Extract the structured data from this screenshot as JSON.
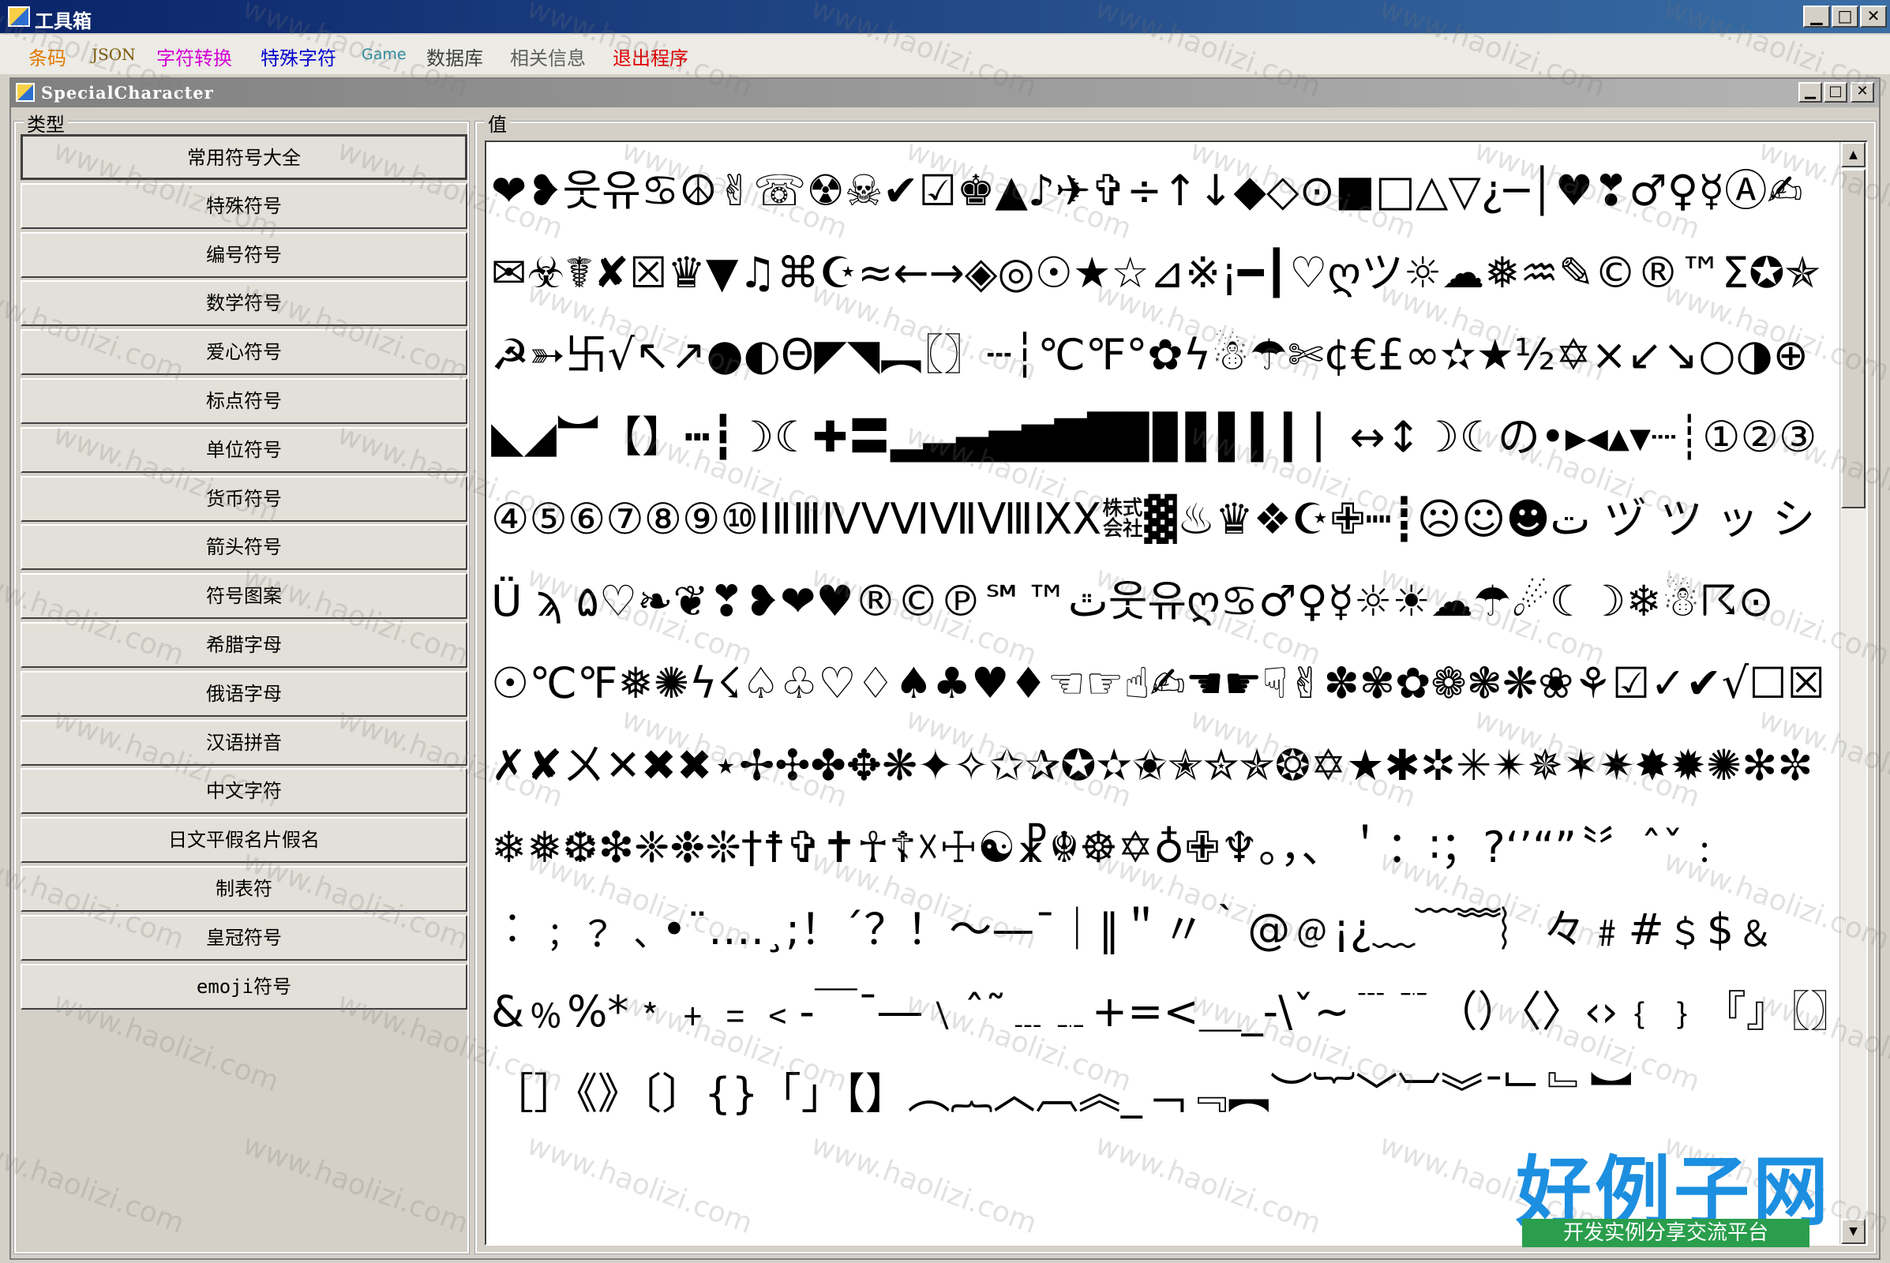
{
  "window": {
    "title": "工具箱",
    "btn_min": "▁",
    "btn_max": "□",
    "btn_close": "✕"
  },
  "menu": [
    {
      "label": "条码",
      "color": "#e07a00"
    },
    {
      "label": "JSON",
      "color": "#7a5a00"
    },
    {
      "label": "字符转换",
      "color": "#d400d4"
    },
    {
      "label": "特殊字符",
      "color": "#0000cc"
    },
    {
      "label": "Game",
      "color": "#2c8ca0"
    },
    {
      "label": "数据库",
      "color": "#404040"
    },
    {
      "label": "相关信息",
      "color": "#606060"
    },
    {
      "label": "退出程序",
      "color": "#e00000"
    }
  ],
  "child": {
    "title": "SpecialCharacter",
    "btn_min": "▁",
    "btn_max": "□",
    "btn_close": "✕"
  },
  "left_group": {
    "label": "类型",
    "categories": [
      "常用符号大全",
      "特殊符号",
      "编号符号",
      "数学符号",
      "爱心符号",
      "标点符号",
      "单位符号",
      "货币符号",
      "箭头符号",
      "符号图案",
      "希腊字母",
      "俄语字母",
      "汉语拼音",
      "中文字符",
      "日文平假名片假名",
      "制表符",
      "皇冠符号",
      "emoji符号"
    ]
  },
  "right_group": {
    "label": "值",
    "content": "❤❥웃유♋☮✌☏☢☠✔☑♚▲♪✈✞÷↑↓◆◇⊙■□△▽¿─│♥❣♂♀☿Ⓐ✍✉☣☤✘☒♛▼♫⌘☪≈←→◈◎☉★☆⊿※¡━┃♡ღツ☼☁❅♒✎©®™Σ✪✯☭➳卐√↖↗●◐Θ◤◥︻〖〗┄┆℃℉°✿ϟ☃☂✄¢€£∞✫★½✡×↙↘○◑⊕◣◢︼【】┅┇☽☾✚〓▂▃▄▅▆▇█▉▊▋▌▍▎▏↔↕☽☾の•▸◂▴▾┈┊①②③④⑤⑥⑦⑧⑨⑩ⅠⅡⅢⅣⅤⅥⅦⅧⅨⅩ㍿▓♨♛❖☪✙┉┋☹☺☻ت ヅ ツ ッ シ Ü ϡ ﭢ™℠℗©®♥❤❥❣❦❧♡۵웃유ღ♋♂♀☿☼☀☁☂☄☾☽❄☃☈⊙☉℃℉❅✺ϟ☇♤♧♡♢♠♣♥♦☜☞☝✍☚☛☟✌✽✾✿❁❃❋❀⚘☑✓✔√☐☒✗✘ㄨ✕✖✖⋆✢✣✤✥❋✦✧✩✰✪✫✬✭✮✯❂✡★✱✲✳✴✵✶✷✸✹✺✻✼❄❅❆❇❈❉❊†☨✞✝☥☦☓☩☯☧☬☸✡♁✙♆。，、＇：∶；?‘’“”〝〞ˆˇ﹕︰﹔﹖﹑•¨….¸;！´？！～—ˉ｜‖＂〃｀@﹫¡¿﹏﹋﹌︴々﹟#﹩$﹠&﹪%*﹡﹢﹦﹤‐￣¯―﹨ˆ˜﹍﹎+=<＿_-\\ˇ~﹉﹊（）〈〉‹›﹛﹜『』〖〗［］《》〔〕{}「」【】︵︷︿︹︽_﹁﹃︻︶︸﹀︺︾ˉ﹂﹄︼"
  },
  "watermark": "www.haolizi.com",
  "logo": {
    "main": "好例子网",
    "sub": "开发实例分享交流平台"
  }
}
